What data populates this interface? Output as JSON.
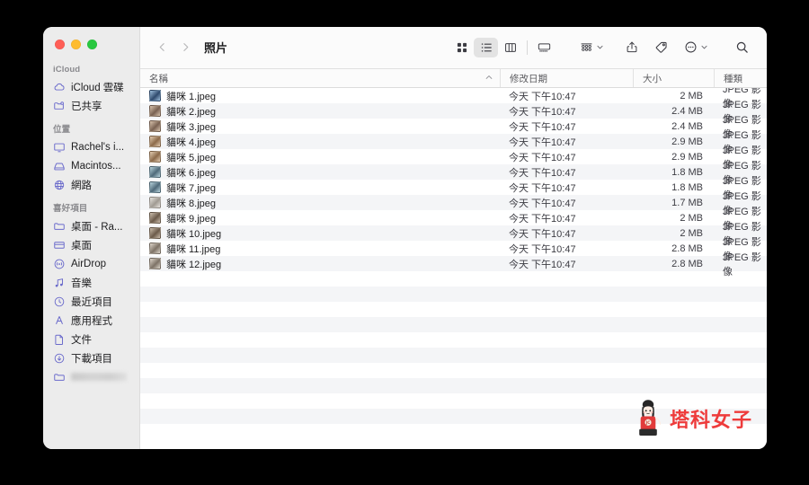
{
  "window": {
    "title": "照片",
    "traffic_lights": {
      "close": "close-red",
      "minimize": "minimize-yellow",
      "zoom": "zoom-green"
    }
  },
  "toolbar": {
    "back_label": "‹",
    "forward_label": "›",
    "icons": [
      {
        "name": "icon-view",
        "label": "圖像顯示方式"
      },
      {
        "name": "list-view",
        "label": "列表顯示方式"
      },
      {
        "name": "column-view",
        "label": "直欄顯示方式"
      },
      {
        "name": "gallery-view",
        "label": "畫廊顯示方式"
      },
      {
        "name": "group-by",
        "label": "群組方式"
      },
      {
        "name": "share",
        "label": "分享"
      },
      {
        "name": "tags",
        "label": "標記"
      },
      {
        "name": "more-actions",
        "label": "更多"
      },
      {
        "name": "search",
        "label": "搜尋"
      }
    ],
    "active_view": "list-view"
  },
  "sidebar": {
    "sections": [
      {
        "title": "iCloud",
        "items": [
          {
            "label": "iCloud 雲碟",
            "icon": "cloud-icon"
          },
          {
            "label": "已共享",
            "icon": "shared-folder-icon"
          }
        ]
      },
      {
        "title": "位置",
        "items": [
          {
            "label": "Rachel's i...",
            "icon": "display-icon"
          },
          {
            "label": "Macintos...",
            "icon": "harddisk-icon"
          },
          {
            "label": "網路",
            "icon": "network-globe-icon"
          }
        ]
      },
      {
        "title": "喜好項目",
        "items": [
          {
            "label": "桌面 - Ra...",
            "icon": "folder-icon"
          },
          {
            "label": "桌面",
            "icon": "desktop-folder-icon"
          },
          {
            "label": "AirDrop",
            "icon": "airdrop-icon"
          },
          {
            "label": "音樂",
            "icon": "music-note-icon"
          },
          {
            "label": "最近項目",
            "icon": "clock-icon"
          },
          {
            "label": "應用程式",
            "icon": "applications-icon"
          },
          {
            "label": "文件",
            "icon": "document-icon"
          },
          {
            "label": "下載項目",
            "icon": "download-icon"
          },
          {
            "label": "",
            "icon": "folder-icon",
            "redacted": true
          }
        ]
      }
    ]
  },
  "file_list": {
    "columns": [
      {
        "key": "name",
        "label": "名稱",
        "sorted": true,
        "sort_direction": "ascending",
        "sort_glyph": "⌃"
      },
      {
        "key": "date",
        "label": "修改日期"
      },
      {
        "key": "size",
        "label": "大小"
      },
      {
        "key": "kind",
        "label": "種類"
      }
    ],
    "rows": [
      {
        "name": "貓咪 1.jpeg",
        "date": "今天 下午10:47",
        "size": "2 MB",
        "kind": "JPEG 影像"
      },
      {
        "name": "貓咪 2.jpeg",
        "date": "今天 下午10:47",
        "size": "2.4 MB",
        "kind": "JPEG 影像"
      },
      {
        "name": "貓咪 3.jpeg",
        "date": "今天 下午10:47",
        "size": "2.4 MB",
        "kind": "JPEG 影像"
      },
      {
        "name": "貓咪 4.jpeg",
        "date": "今天 下午10:47",
        "size": "2.9 MB",
        "kind": "JPEG 影像"
      },
      {
        "name": "貓咪 5.jpeg",
        "date": "今天 下午10:47",
        "size": "2.9 MB",
        "kind": "JPEG 影像"
      },
      {
        "name": "貓咪 6.jpeg",
        "date": "今天 下午10:47",
        "size": "1.8 MB",
        "kind": "JPEG 影像"
      },
      {
        "name": "貓咪 7.jpeg",
        "date": "今天 下午10:47",
        "size": "1.8 MB",
        "kind": "JPEG 影像"
      },
      {
        "name": "貓咪 8.jpeg",
        "date": "今天 下午10:47",
        "size": "1.7 MB",
        "kind": "JPEG 影像"
      },
      {
        "name": "貓咪 9.jpeg",
        "date": "今天 下午10:47",
        "size": "2 MB",
        "kind": "JPEG 影像"
      },
      {
        "name": "貓咪 10.jpeg",
        "date": "今天 下午10:47",
        "size": "2 MB",
        "kind": "JPEG 影像"
      },
      {
        "name": "貓咪 11.jpeg",
        "date": "今天 下午10:47",
        "size": "2.8 MB",
        "kind": "JPEG 影像"
      },
      {
        "name": "貓咪 12.jpeg",
        "date": "今天 下午10:47",
        "size": "2.8 MB",
        "kind": "JPEG 影像"
      }
    ],
    "empty_row_count": 11
  },
  "watermark": {
    "text": "塔科女子",
    "color": "#ee3b3b"
  },
  "colors": {
    "sidebar_bg": "#ececec",
    "toolbar_bg": "#fbfbfb",
    "row_alt_bg": "#f4f5f7",
    "sidebar_icon": "#6a6acb",
    "desktop_bg": "#000000"
  }
}
